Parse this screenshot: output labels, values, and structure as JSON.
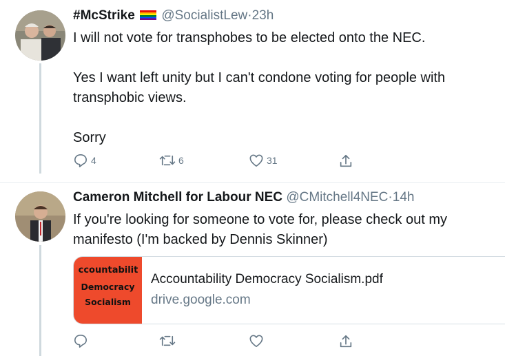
{
  "tweets": [
    {
      "display_name": "#McStrike",
      "emoji": "🏳️‍🌈",
      "handle": "@SocialistLew",
      "separator": "·",
      "time": "23h",
      "text": "I will not vote for transphobes to be elected onto the NEC.\n\nYes I want left unity but I can't condone voting for people with transphobic views.\n\nSorry",
      "replies": "4",
      "retweets": "6",
      "likes": "31"
    },
    {
      "display_name": "Cameron Mitchell for Labour NEC",
      "handle": "@CMitchell4NEC",
      "separator": "·",
      "time": "14h",
      "text": "If you're looking for someone to vote for, please check out my manifesto (I'm backed by Dennis Skinner)",
      "card": {
        "thumb_lines": [
          "ccountabilit",
          "Democracy",
          "Socialism"
        ],
        "title": "Accountability Democracy Socialism.pdf",
        "domain": "drive.google.com"
      }
    }
  ],
  "icons": [
    "reply-icon",
    "retweet-icon",
    "like-icon",
    "share-icon"
  ],
  "colors": {
    "meta": "#657786",
    "thread_line": "#cfd9de",
    "card_thumb": "#ee4a2c"
  }
}
